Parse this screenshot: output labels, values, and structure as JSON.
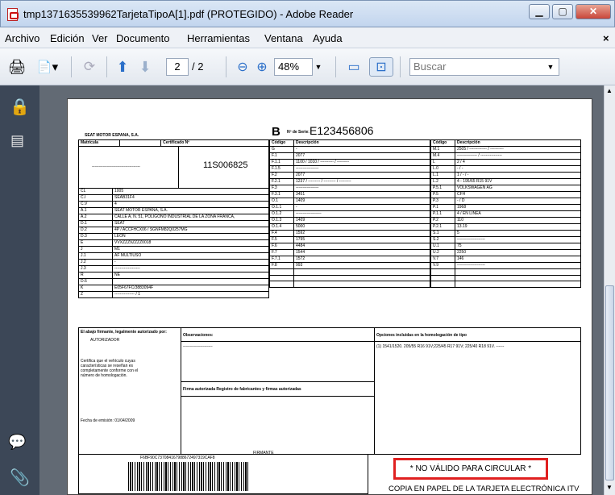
{
  "window": {
    "title": "tmp1371635539962TarjetaTipoA[1].pdf (PROTEGIDO) - Adobe Reader",
    "minimize": "▁",
    "maximize": "▢",
    "close": "✕"
  },
  "menu": {
    "items": [
      "Archivo",
      "Edición",
      "Ver",
      "Documento",
      "Herramientas",
      "Ventana",
      "Ayuda"
    ],
    "close": "×"
  },
  "toolbar": {
    "page_current": "2",
    "page_total": "/ 2",
    "zoom": "48%",
    "search_placeholder": "Buscar"
  },
  "doc": {
    "company": "SEAT MOTOR ESPAÑA, S.A.",
    "type_letter": "B",
    "serial_label": "Nº de Serie:",
    "serial": "E123456806",
    "col_matricula": "Matrícula",
    "col_cert": "Certificado Nº",
    "cert_num": "11S006825",
    "matricula_dashes": "------------------------------------",
    "col_codigo": "Código",
    "col_desc": "Descripción",
    "left_rows": [
      [
        "CL",
        "1005"
      ],
      [
        "C.I",
        "SEAB31F4"
      ],
      [
        "C.V",
        "4"
      ],
      [
        "A.1",
        "SEAT MOTOR ESPAÑA, S.A."
      ],
      [
        "A.2",
        "CALLE A, N. 51, POLIGONO INDUSTRIAL DE LA ZONA FRANCA,"
      ],
      [
        "D.1",
        "SEAT"
      ],
      [
        "D.2",
        "4P / ACCFHCX06 / SGNFM82Q0257MG"
      ],
      [
        "D.3",
        "LEON"
      ],
      [
        "E",
        "VVXZZZ9ZZZZ0018"
      ],
      [
        "J",
        "M1"
      ],
      [
        "J.1",
        "AF MULTIUSO"
      ],
      [
        "J.2",
        "-"
      ],
      [
        "J.3",
        "-------------------"
      ],
      [
        "R",
        "NE"
      ],
      [
        "D.6",
        ""
      ],
      [
        "K",
        "E05F67FC/3883094F"
      ],
      [
        "Z",
        "--------------- / 1"
      ]
    ],
    "mid_rows": [
      [
        "G",
        "-"
      ],
      [
        "F.1",
        "2077"
      ],
      [
        "F.1.1",
        "1100 / 1010 / ---------- / ---------"
      ],
      [
        "F.1.5",
        "-----------------"
      ],
      [
        "F.2",
        "2077"
      ],
      [
        "F.2.1",
        "1237 / --------- / --------- / ---------"
      ],
      [
        "F.3",
        "-----------------"
      ],
      [
        "F.3.1",
        "3451"
      ],
      [
        "O.1",
        "1409"
      ],
      [
        "O.1.1",
        "-"
      ],
      [
        "O.1.2",
        "-------------------"
      ],
      [
        "O.1.3",
        "1409"
      ],
      [
        "O.1.4",
        "5000"
      ],
      [
        "F.4",
        "1592"
      ],
      [
        "F.5",
        "1795"
      ],
      [
        "F.6",
        "4484"
      ],
      [
        "F.7",
        "1544"
      ],
      [
        "F.7.1",
        "1572"
      ],
      [
        "F.8",
        "993"
      ],
      [
        "",
        ""
      ],
      [
        "",
        ""
      ],
      [
        "",
        ""
      ]
    ],
    "right_rows": [
      [
        "M.1",
        "2505 / ------------- / ----------"
      ],
      [
        "M.4",
        "--------------- / ----------------"
      ],
      [
        "L",
        "2 / 4"
      ],
      [
        "L.0",
        "- / -"
      ],
      [
        "L.1",
        "1 / - / -"
      ],
      [
        "L.2",
        "4 - 195/65 R15 91V"
      ],
      [
        "P.5.1",
        "VOLKSWAGEN AG"
      ],
      [
        "P.5",
        "CFH"
      ],
      [
        "P.3",
        "- / D"
      ],
      [
        "P.1",
        "1968"
      ],
      [
        "P.1.1",
        "4 / EN LINEA"
      ],
      [
        "P.2",
        "110"
      ],
      [
        "P.2.1",
        "13.19"
      ],
      [
        "S.1",
        "5"
      ],
      [
        "S.2",
        "---------------------"
      ],
      [
        "U.1",
        "75"
      ],
      [
        "U.2",
        "2250"
      ],
      [
        "V.7",
        "146"
      ],
      [
        "V.9",
        "---------------------"
      ],
      [
        "",
        ""
      ],
      [
        "",
        ""
      ],
      [
        "",
        ""
      ]
    ],
    "firmante_label": "El abajo firmante, legalmente autorizado por:",
    "firmante": "AUTORIZADOR",
    "certifica": "Certifica que el vehículo cuyas características se reseñan es completamente conforme con el número de homologación.",
    "fecha": "Fecha de emisión:  01/04/2009",
    "obs_label": "Observaciones:",
    "obs_value": "----------------------",
    "firma_label": "Firma autorizada Registro de fabricantes y firmas autorizadas",
    "firmante_bottom": "FIRMANTE",
    "opciones_label": "Opciones incluidas en la homologación de tipo",
    "opciones_value": "(1) 1541/1520. 205/55 R16 91V;225/45 R17 91V; 225/40 R18 91V. ------",
    "barcode_text": "F6BF90C737084167988672497319CAF8",
    "no_valido": "* NO VÁLIDO PARA CIRCULAR *",
    "copia": "COPIA EN PAPEL DE LA TARJETA ELECTRÓNICA ITV"
  },
  "colors": {
    "titlebar": "#c2d5ee",
    "viewer_bg": "#626a74",
    "left_pane": "#3c4757",
    "red_box": "#e02020"
  }
}
